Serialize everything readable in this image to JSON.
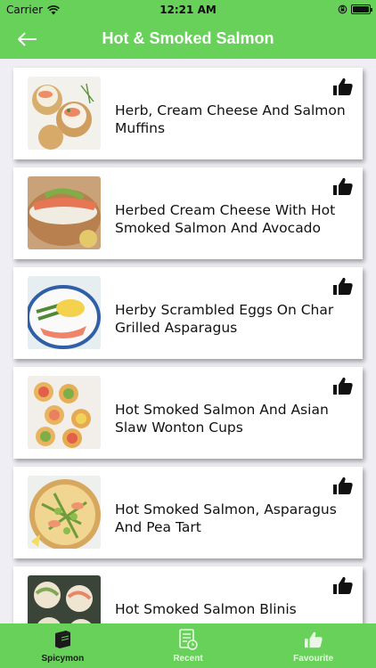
{
  "status_bar": {
    "carrier": "Carrier",
    "time": "12:21 AM",
    "battery_level": 1.0
  },
  "nav": {
    "title": "Hot & Smoked Salmon"
  },
  "recipes": [
    {
      "title": "Herb, Cream Cheese And Salmon Muffins"
    },
    {
      "title": "Herbed Cream Cheese With Hot Smoked Salmon And Avocado"
    },
    {
      "title": "Herby Scrambled Eggs On Char Grilled Asparagus"
    },
    {
      "title": "Hot Smoked Salmon And Asian Slaw Wonton Cups"
    },
    {
      "title": "Hot Smoked Salmon, Asparagus And Pea Tart"
    },
    {
      "title": "Hot Smoked Salmon Blinis"
    }
  ],
  "tabs": [
    {
      "label": "Spicymon",
      "icon": "book-icon",
      "active": true
    },
    {
      "label": "Recent",
      "icon": "recent-list-icon",
      "active": false
    },
    {
      "label": "Favourite",
      "icon": "thumbs-up-icon",
      "active": false
    }
  ],
  "colors": {
    "brand_green": "#67d15a",
    "background": "#efeef4"
  }
}
